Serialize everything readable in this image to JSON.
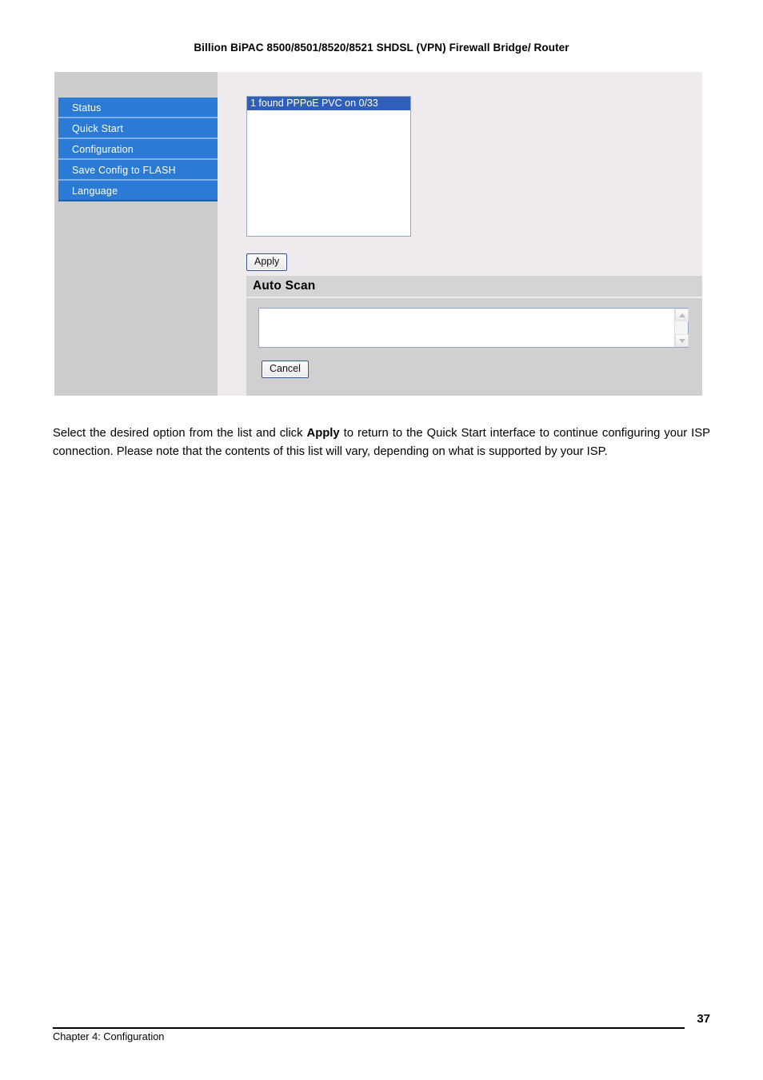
{
  "document": {
    "running_header": "Billion BiPAC 8500/8501/8520/8521 SHDSL (VPN) Firewall Bridge/ Router",
    "body_paragraph_part1": "Select the desired option from the list and click ",
    "body_paragraph_bold": "Apply",
    "body_paragraph_part2": " to return to the Quick Start interface to continue configuring your ISP connection. Please note that the contents of this list will vary, depending on what is supported by your ISP.",
    "footer_label": "Chapter 4: Configuration",
    "page_number": "37"
  },
  "screenshot": {
    "sidebar": {
      "items": [
        {
          "label": "Status"
        },
        {
          "label": "Quick Start"
        },
        {
          "label": "Configuration"
        },
        {
          "label": "Save Config to FLASH"
        },
        {
          "label": "Language"
        }
      ]
    },
    "pvc_list": {
      "options": [
        {
          "label": "1 found PPPoE PVC on 0/33",
          "selected": true
        }
      ]
    },
    "apply_button": "Apply",
    "auto_scan": {
      "title": "Auto Scan",
      "textarea_value": "",
      "cancel_button": "Cancel"
    },
    "colors": {
      "menu_blue": "#2b7ad4",
      "menu_separator": "#7eb1e8",
      "selection_blue": "#2f5fb8",
      "content_background": "#efeaee",
      "sidebar_background": "#cdcdcd",
      "section_bar": "#d4d4d4",
      "section_body": "#d0d0d0",
      "button_border": "#33568f"
    }
  }
}
